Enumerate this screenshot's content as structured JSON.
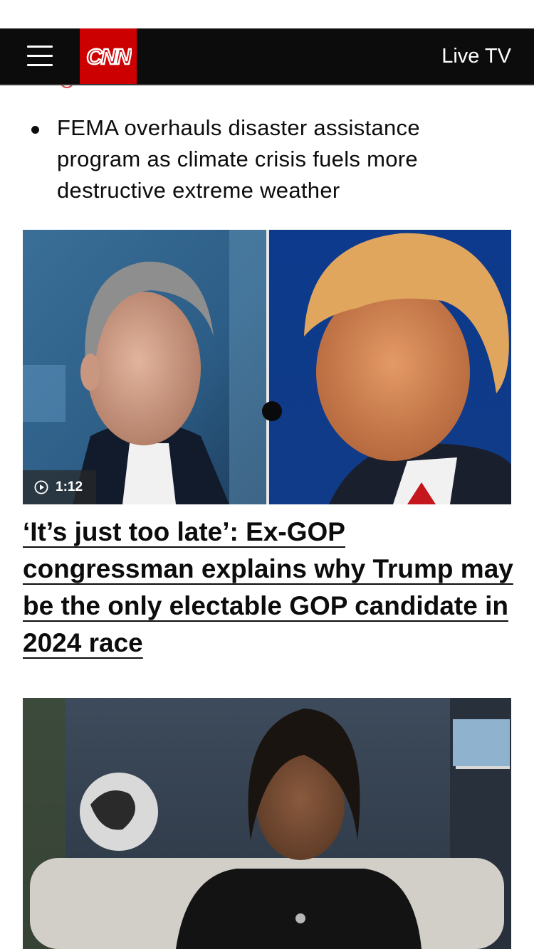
{
  "header": {
    "menu_icon": "hamburger-menu-icon",
    "logo_text": "CNN",
    "live_tv_label": "Live TV",
    "brand_color": "#cc0000",
    "bar_color": "#0c0c0c"
  },
  "previous_item": {
    "bullet_text": "FEMA overhauls disaster assistance program as climate crisis fuels more destructive extreme weather"
  },
  "video_card": {
    "duration": "1:12",
    "play_icon": "play-circle-icon",
    "headline": "‘It’s just too late’: Ex-GOP congressman explains why Trump may be the only electable GOP candidate in 2024 race"
  },
  "next_card": {
    "image_icon": "story-thumbnail"
  }
}
